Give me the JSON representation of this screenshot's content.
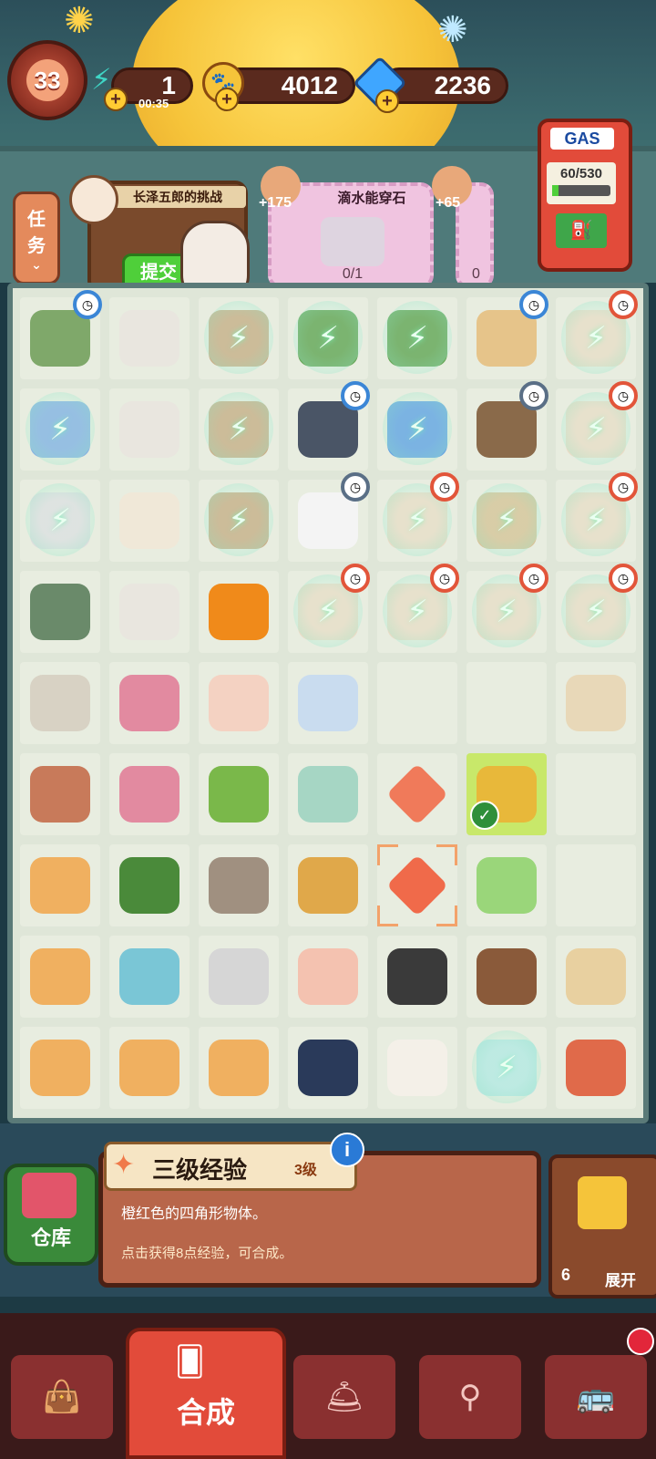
{
  "header": {
    "level": "33",
    "energy": {
      "value": "1",
      "timer": "00:35",
      "icon": "energy-icon"
    },
    "coins": {
      "value": "4012",
      "icon": "paw-coin-icon"
    },
    "gems": {
      "value": "2236",
      "icon": "gem-icon"
    }
  },
  "tasks_button": {
    "label_line1": "任",
    "label_line2": "务"
  },
  "quests": [
    {
      "title": "长泽五郎的挑战",
      "button": "提交"
    },
    {
      "title": "滴水能穿石",
      "reward": "+175",
      "progress": "0/1"
    },
    {
      "reward": "+65",
      "progress": "0"
    }
  ],
  "gas": {
    "label": "GAS",
    "value": "60/530"
  },
  "board": {
    "rows": [
      [
        {
          "n": "scooter",
          "timer": "blue"
        },
        {
          "n": "printer"
        },
        {
          "n": "pot-bubble"
        },
        {
          "n": "bonsai-bubble"
        },
        {
          "n": "bonsai-bubble"
        },
        {
          "n": "spice-rack",
          "timer": "blue"
        },
        {
          "n": "roll-bubble",
          "timer": "red"
        }
      ],
      [
        {
          "n": "locker-bubble"
        },
        {
          "n": "printer"
        },
        {
          "n": "pot-bubble"
        },
        {
          "n": "chef-jacket",
          "timer": "blue"
        },
        {
          "n": "notebook-bubble"
        },
        {
          "n": "spice-shelf",
          "timer": "gray"
        },
        {
          "n": "roll-bubble",
          "timer": "red"
        }
      ],
      [
        {
          "n": "oven-bubble"
        },
        {
          "n": "receipt-printer"
        },
        {
          "n": "pot-bubble"
        },
        {
          "n": "chef-hat",
          "timer": "gray"
        },
        {
          "n": "roll-bubble",
          "timer": "red"
        },
        {
          "n": "spice-shelf-bubble"
        },
        {
          "n": "roll-bubble",
          "timer": "red"
        }
      ],
      [
        {
          "n": "hand-truck"
        },
        {
          "n": "printer"
        },
        {
          "n": "orange-vase"
        },
        {
          "n": "roll-bubble",
          "timer": "red"
        },
        {
          "n": "roll-bubble",
          "timer": "red"
        },
        {
          "n": "roll-bubble",
          "timer": "red"
        },
        {
          "n": "roll-bubble",
          "timer": "red"
        }
      ],
      [
        {
          "n": "calendar"
        },
        {
          "n": "dustpan"
        },
        {
          "n": "jar"
        },
        {
          "n": "snowflake"
        },
        {
          "n": "empty"
        },
        {
          "n": "empty"
        },
        {
          "n": "rice-board"
        }
      ],
      [
        {
          "n": "picture-frame"
        },
        {
          "n": "dustpan"
        },
        {
          "n": "seedling"
        },
        {
          "n": "ruler"
        },
        {
          "n": "gem-shard"
        },
        {
          "n": "buddha-jar",
          "check": true
        },
        {
          "n": "empty"
        }
      ],
      [
        {
          "n": "meat-box"
        },
        {
          "n": "sprout"
        },
        {
          "n": "plug"
        },
        {
          "n": "shopping-bag"
        },
        {
          "n": "orange-star",
          "selected": true
        },
        {
          "n": "cabbage"
        },
        {
          "n": "empty"
        }
      ],
      [
        {
          "n": "meat-box"
        },
        {
          "n": "puzzle"
        },
        {
          "n": "paint-box"
        },
        {
          "n": "envelope"
        },
        {
          "n": "sushi"
        },
        {
          "n": "chocolate-plate"
        },
        {
          "n": "beans-board"
        }
      ],
      [
        {
          "n": "meat-box"
        },
        {
          "n": "meat-box"
        },
        {
          "n": "meat-box"
        },
        {
          "n": "ink-bottle"
        },
        {
          "n": "rice-plate"
        },
        {
          "n": "steamed-bubble"
        },
        {
          "n": "skewers"
        }
      ]
    ]
  },
  "info": {
    "title": "三级经验",
    "level": "3级",
    "desc1": "橙红色的四角形物体。",
    "desc2": "点击获得8点经验，可合成。",
    "warehouse": "仓库",
    "expand_count": "6",
    "expand_label": "展开"
  },
  "nav": {
    "merge": "合成"
  },
  "colors": {
    "accent": "#e24b3a",
    "board": "#dfe6d8",
    "panel": "#b8664a"
  }
}
